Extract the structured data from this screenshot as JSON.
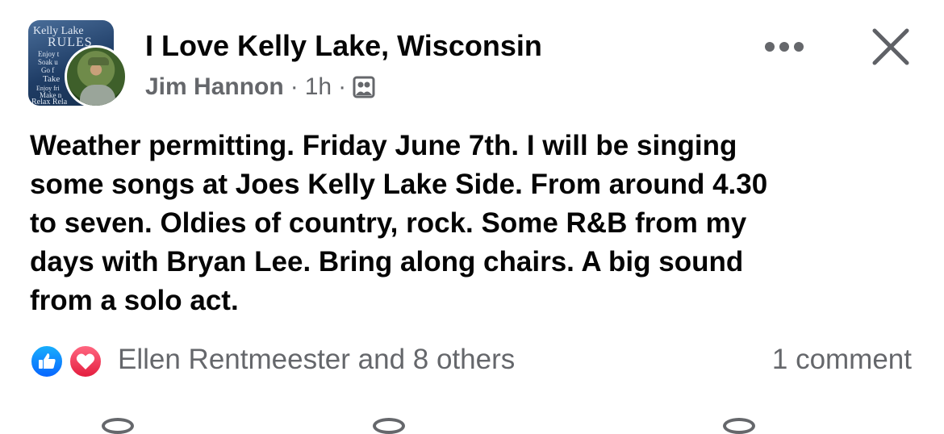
{
  "header": {
    "group_name": "I Love Kelly Lake, Wisconsin",
    "author": "Jim Hannon",
    "separator_1": "·",
    "time": "1h",
    "separator_2": "·",
    "audience_icon": "members-group-icon",
    "more_icon": "more-horizontal-icon",
    "close_icon": "close-icon"
  },
  "group_avatar": {
    "lines": [
      "Kelly Lake",
      "RULES",
      "Enjoy t",
      "Soak u",
      "Go f",
      "Take",
      "Enjoy fri",
      "Make n",
      "Relax Rela"
    ]
  },
  "post": {
    "text": "Weather permitting.  Friday June 7th. I will be  singing\nsome songs at Joes Kelly Lake Side.  From around 4.30\nto seven. Oldies of country, rock.  Some R&B from my\ndays with Bryan Lee. Bring along chairs.  A big sound\nfrom a solo act."
  },
  "engagement": {
    "reaction_icons": [
      "like-icon",
      "love-icon"
    ],
    "reactors": "Ellen Rentmeester and 8 others",
    "comments": "1 comment"
  },
  "colors": {
    "text_primary": "#050505",
    "text_secondary": "#65676b",
    "like_blue": "#0866ff",
    "love_red": "#e41e3f"
  }
}
